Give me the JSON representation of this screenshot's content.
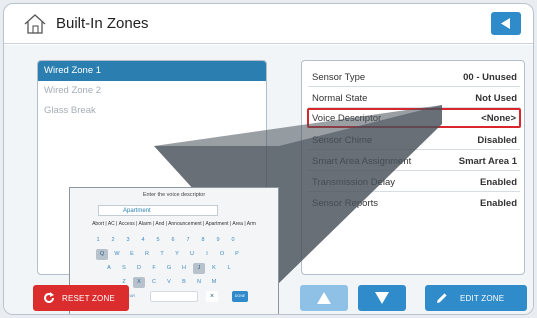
{
  "header": {
    "title": "Built-In Zones"
  },
  "zones": [
    {
      "label": "Wired Zone 1"
    },
    {
      "label": "Wired Zone 2"
    },
    {
      "label": "Glass Break"
    }
  ],
  "properties": [
    {
      "key": "Sensor Type",
      "value": "00 - Unused"
    },
    {
      "key": "Normal State",
      "value": "Not Used"
    },
    {
      "key": "Voice Descriptor",
      "value": "<None>"
    },
    {
      "key": "Sensor Chime",
      "value": "Disabled"
    },
    {
      "key": "Smart Area Assignment",
      "value": "Smart Area 1"
    },
    {
      "key": "Transmission Delay",
      "value": "Enabled"
    },
    {
      "key": "Sensor Reports",
      "value": "Enabled"
    }
  ],
  "keyboard": {
    "title": "Enter the voice descriptor",
    "input_value": "Apartment",
    "suggestions": "Abort | AC | Access | Alarm | And | Announcement | Apartment | Area | Arm",
    "row1": [
      "1",
      "2",
      "3",
      "4",
      "5",
      "6",
      "7",
      "8",
      "9",
      "0"
    ],
    "row2": [
      "Q",
      "W",
      "E",
      "R",
      "T",
      "Y",
      "U",
      "I",
      "O",
      "P"
    ],
    "row3": [
      "A",
      "S",
      "D",
      "F",
      "G",
      "H",
      "J",
      "K",
      "L"
    ],
    "row4": [
      "Z",
      "X",
      "C",
      "V",
      "B",
      "N",
      "M"
    ],
    "clear_label": "CLEAR",
    "backspace_label": "×",
    "done_label": "DONE"
  },
  "buttons": {
    "reset": "RESET ZONE",
    "edit": "EDIT ZONE"
  },
  "colors": {
    "accent": "#2f8bc9",
    "selected": "#2a7fb0",
    "danger": "#db2d2e",
    "highlight": "#d9262c"
  }
}
